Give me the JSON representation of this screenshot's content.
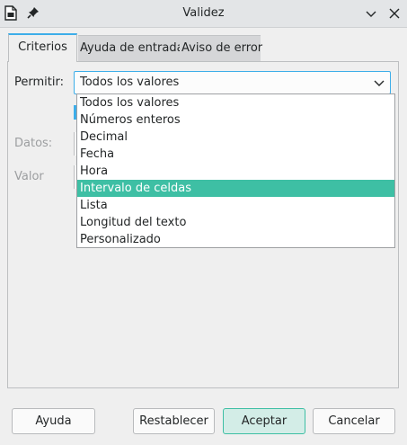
{
  "window": {
    "title": "Validez"
  },
  "tabs": [
    {
      "label": "Criterios"
    },
    {
      "label": "Ayuda de entrada"
    },
    {
      "label": "Aviso de error"
    }
  ],
  "form": {
    "permitir_label": "Permitir:",
    "permitir_value": "Todos los valores",
    "datos_label": "Datos:",
    "valor_label": "Valor"
  },
  "dropdown": {
    "options": [
      "Todos los valores",
      "Números enteros",
      "Decimal",
      "Fecha",
      "Hora",
      "Intervalo de celdas",
      "Lista",
      "Longitud del texto",
      "Personalizado"
    ],
    "highlighted": "Intervalo de celdas"
  },
  "buttons": {
    "help": "Ayuda",
    "reset": "Restablecer",
    "ok": "Aceptar",
    "cancel": "Cancelar"
  },
  "colors": {
    "accent": "#3daee9",
    "selection": "#3ebfa4"
  }
}
